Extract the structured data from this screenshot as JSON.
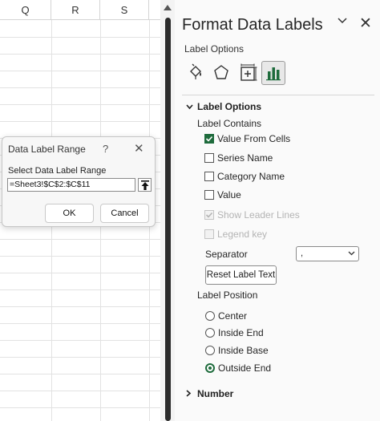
{
  "sheet": {
    "columns": [
      "Q",
      "R",
      "S"
    ]
  },
  "dialog": {
    "title": "Data Label Range",
    "help_glyph": "?",
    "close_glyph": "✕",
    "field_label": "Select Data Label Range",
    "range_value": "=Sheet3!$C$2:$C$11",
    "ok_label": "OK",
    "cancel_label": "Cancel"
  },
  "pane": {
    "title": "Format Data Labels",
    "close_glyph": "✕",
    "subtitle": "Label Options",
    "tabs": [
      "fill-line-icon",
      "effects-icon",
      "size-properties-icon",
      "label-options-icon"
    ],
    "active_tab": "label-options-icon",
    "accent_color": "#1e6b3c",
    "label_options": {
      "heading": "Label Options",
      "contains_label": "Label Contains",
      "checkboxes": [
        {
          "label": "Value From Cells",
          "checked": true,
          "disabled": false
        },
        {
          "label": "Series Name",
          "checked": false,
          "disabled": false
        },
        {
          "label": "Category Name",
          "checked": false,
          "disabled": false
        },
        {
          "label": "Value",
          "checked": false,
          "disabled": false
        },
        {
          "label": "Show Leader Lines",
          "checked": true,
          "disabled": true
        },
        {
          "label": "Legend key",
          "checked": false,
          "disabled": true
        }
      ],
      "separator_label": "Separator",
      "separator_value": ",",
      "reset_label": "Reset Label Text",
      "position_label": "Label Position",
      "positions": [
        {
          "label": "Center",
          "selected": false
        },
        {
          "label": "Inside End",
          "selected": false
        },
        {
          "label": "Inside Base",
          "selected": false
        },
        {
          "label": "Outside End",
          "selected": true
        }
      ]
    },
    "number_section": {
      "heading": "Number"
    }
  }
}
